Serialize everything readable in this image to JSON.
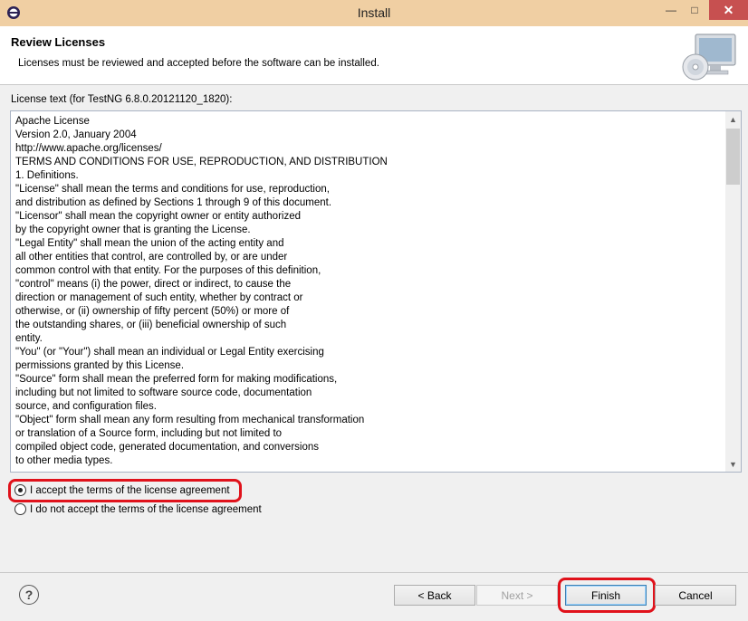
{
  "window": {
    "title": "Install"
  },
  "header": {
    "title": "Review Licenses",
    "description": "Licenses must be reviewed and accepted before the software can be installed."
  },
  "license": {
    "label": "License text (for TestNG 6.8.0.20121120_1820):",
    "text": "Apache License\nVersion 2.0, January 2004\nhttp://www.apache.org/licenses/\nTERMS AND CONDITIONS FOR USE, REPRODUCTION, AND DISTRIBUTION\n1. Definitions.\n\"License\" shall mean the terms and conditions for use, reproduction,\nand distribution as defined by Sections 1 through 9 of this document.\n\"Licensor\" shall mean the copyright owner or entity authorized\nby the copyright owner that is granting the License.\n\"Legal Entity\" shall mean the union of the acting entity and\nall other entities that control, are controlled by, or are under\ncommon control with that entity. For the purposes of this definition,\n\"control\" means (i) the power, direct or indirect, to cause the\ndirection or management of such entity, whether by contract or\notherwise, or (ii) ownership of fifty percent (50%) or more of\nthe outstanding shares, or (iii) beneficial ownership of such\nentity.\n\"You\" (or \"Your\") shall mean an individual or Legal Entity exercising\npermissions granted by this License.\n\"Source\" form shall mean the preferred form for making modifications,\nincluding but not limited to software source code, documentation\nsource, and configuration files.\n\"Object\" form shall mean any form resulting from mechanical transformation\nor translation of a Source form, including but not limited to\ncompiled object code, generated documentation, and conversions\nto other media types."
  },
  "options": {
    "accept_label": "I accept the terms of the license agreement",
    "decline_label": "I do not accept the terms of the license agreement",
    "selected": "accept"
  },
  "footer": {
    "back_label": "< Back",
    "next_label": "Next >",
    "finish_label": "Finish",
    "cancel_label": "Cancel"
  },
  "colors": {
    "titlebar": "#f0cfa3",
    "close": "#c75050",
    "highlight": "#e0121b"
  },
  "icons": [
    "eclipse-icon",
    "minimize-icon",
    "maximize-icon",
    "close-icon",
    "computer-cd-icon",
    "help-icon",
    "scroll-up-icon",
    "scroll-down-icon"
  ]
}
